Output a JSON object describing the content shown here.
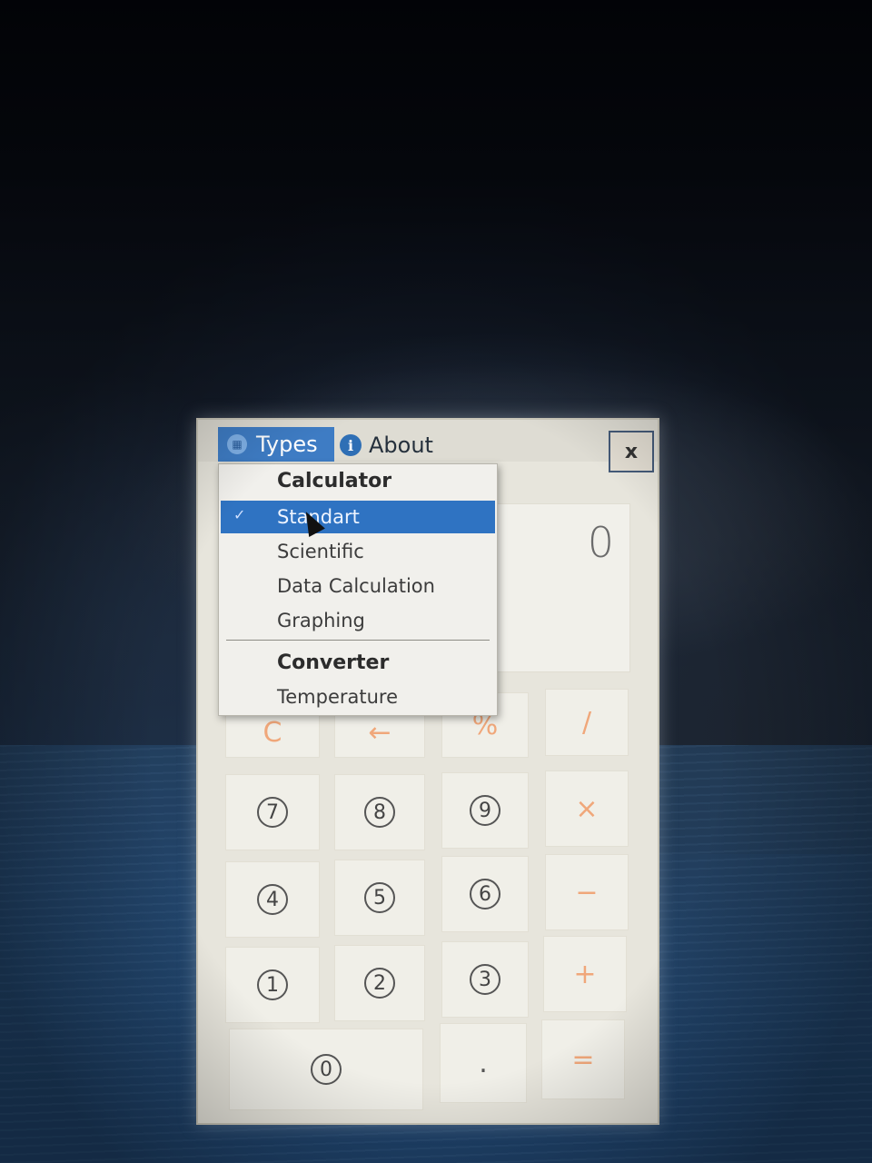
{
  "menubar": {
    "types_label": "Types",
    "about_label": "About",
    "types_icon": "grid-icon",
    "about_icon": "info-icon"
  },
  "window": {
    "close_label": "x"
  },
  "display": {
    "value": "0"
  },
  "dropdown": {
    "calculator_header": "Calculator",
    "calculator_items": [
      {
        "label": "Standart",
        "selected": true
      },
      {
        "label": "Scientific",
        "selected": false
      },
      {
        "label": "Data Calculation",
        "selected": false
      },
      {
        "label": "Graphing",
        "selected": false
      }
    ],
    "converter_header": "Converter",
    "converter_items": [
      {
        "label": "Temperature",
        "selected": false
      }
    ],
    "check_mark": "✓"
  },
  "keypad": {
    "row1": [
      "C",
      "←",
      "%",
      "/"
    ],
    "row2": [
      "7",
      "8",
      "9",
      "×"
    ],
    "row3": [
      "4",
      "5",
      "6",
      "−"
    ],
    "row4": [
      "1",
      "2",
      "3",
      "+"
    ],
    "row5": [
      "0",
      ".",
      "="
    ]
  },
  "colors": {
    "accent": "#2f73c2",
    "operator": "#f0a77a"
  }
}
